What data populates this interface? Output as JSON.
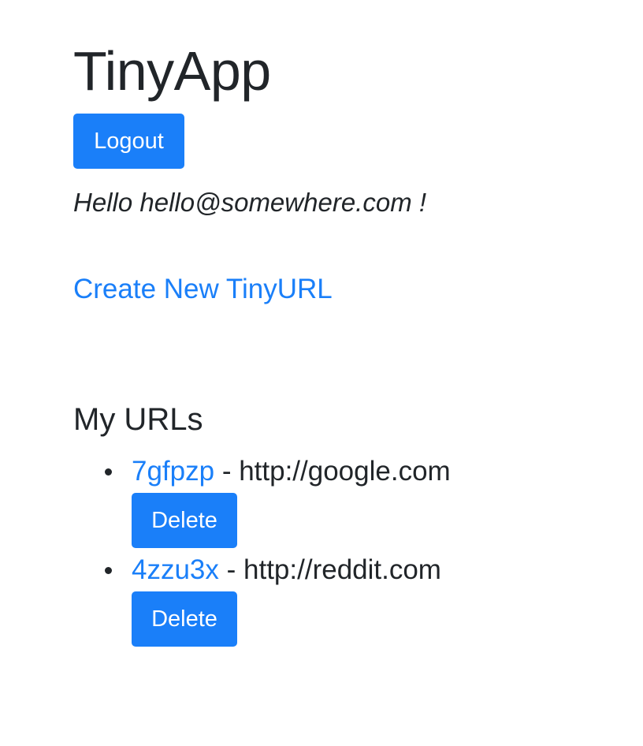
{
  "header": {
    "title": "TinyApp",
    "logout_label": "Logout",
    "greeting": "Hello hello@somewhere.com !"
  },
  "nav": {
    "create_link_label": "Create New TinyURL"
  },
  "urls": {
    "heading": "My URLs",
    "separator": " - ",
    "items": [
      {
        "short": "7gfpzp",
        "long": "http://google.com",
        "delete_label": "Delete"
      },
      {
        "short": "4zzu3x",
        "long": "http://reddit.com",
        "delete_label": "Delete"
      }
    ]
  },
  "colors": {
    "primary": "#1a7ff9",
    "text": "#212529",
    "background": "#ffffff"
  }
}
